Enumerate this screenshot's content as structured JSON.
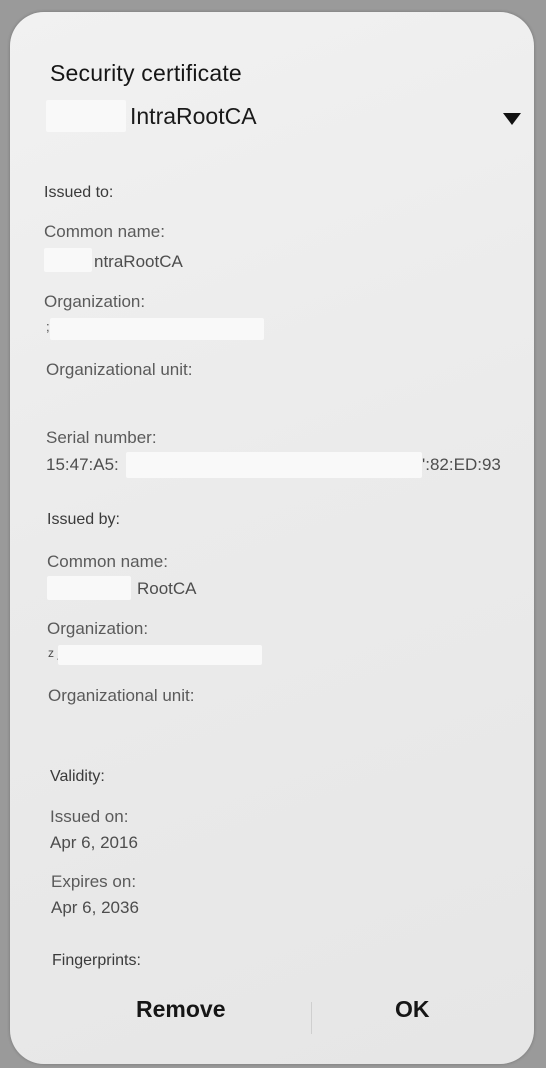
{
  "dialog": {
    "title": "Security certificate",
    "certificate_select": {
      "selected": "IntraRootCA"
    }
  },
  "issued_to": {
    "heading": "Issued to:",
    "common_name_label": "Common name:",
    "common_name_value": "ntraRootCA",
    "organization_label": "Organization:",
    "organization_value": ";",
    "org_unit_label": "Organizational unit:",
    "serial_label": "Serial number:",
    "serial_value_start": "15:47:A5:",
    "serial_value_end": "':82:ED:93"
  },
  "issued_by": {
    "heading": "Issued by:",
    "common_name_label": "Common name:",
    "common_name_value": "RootCA",
    "organization_label": "Organization:",
    "organization_value": "z _",
    "org_unit_label": "Organizational unit:"
  },
  "validity": {
    "heading": "Validity:",
    "issued_on_label": "Issued on:",
    "issued_on_value": "Apr 6, 2016",
    "expires_on_label": "Expires on:",
    "expires_on_value": "Apr 6, 2036"
  },
  "fingerprints": {
    "heading": "Fingerprints:"
  },
  "actions": {
    "remove_label": "Remove",
    "ok_label": "OK"
  },
  "colors": {
    "dialog_background": "#ededed",
    "backdrop": "#9a9a9a",
    "text_primary": "#161616",
    "text_secondary": "#5a5a5a"
  },
  "icons": {
    "certificate_dropdown": "caret-down-icon"
  }
}
